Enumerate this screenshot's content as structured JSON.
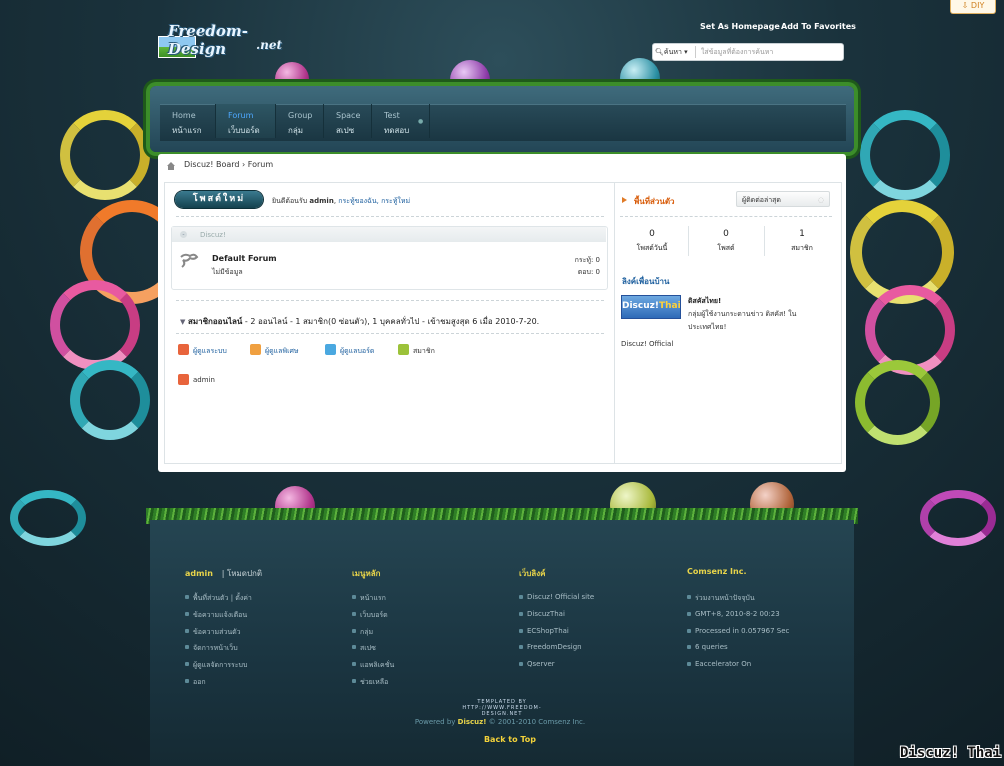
{
  "header": {
    "logo_text": "Freedom-Design",
    "logo_sub": ".net",
    "set_homepage": "Set As Homepage",
    "add_favorites": "Add To Favorites",
    "diy": "DIY",
    "search_select": "ค้นหา",
    "search_placeholder": "ใส่ข้อมูลที่ต้องการค้นหา"
  },
  "nav": {
    "items": [
      {
        "en": "Home",
        "th": "หน้าแรก"
      },
      {
        "en": "Forum",
        "th": "เว็บบอร์ด"
      },
      {
        "en": "Group",
        "th": "กลุ่ม"
      },
      {
        "en": "Space",
        "th": "สเปซ"
      },
      {
        "en": "Test",
        "th": "ทดสอบ"
      }
    ],
    "active_index": 1
  },
  "breadcrumb": {
    "board": "Discuz! Board",
    "sep": "›",
    "forum": "Forum"
  },
  "main": {
    "post_button": "โพสต์ใหม่",
    "welcome_prefix": "ยินดีต้อนรับ",
    "welcome_user": "admin",
    "welcome_rest": "กระทู้ของฉัน, กระทู้ใหม่",
    "category": {
      "title": "Discuz!",
      "forum_name": "Default Forum",
      "forum_desc": "ไม่มีข้อมูล",
      "threads": "กระทู้: 0",
      "posts": "ตอบ: 0"
    },
    "online": {
      "title": "สมาชิกออนไลน์",
      "summary": " - 2 ออนไลน์ - 1 สมาชิก(0 ซ่อนตัว), 1 บุคคลทั่วไป - เข้าชมสูงสุด 6 เมื่อ 2010-7-20.",
      "legends": [
        "ผู้ดูแลระบบ",
        "ผู้ดูแลพิเศษ",
        "ผู้ดูแลบอร์ด",
        "สมาชิก"
      ],
      "legend_colors": [
        "#e8643c",
        "#f0a040",
        "#4aa8e0",
        "#9cc23a"
      ],
      "user": "admin"
    }
  },
  "sidebar": {
    "title": "พื้นที่ส่วนตัว",
    "latest_button": "ผู้ติดต่อล่าสุด",
    "stats": [
      {
        "num": "0",
        "label": "โพสต์วันนี้"
      },
      {
        "num": "0",
        "label": "โพสต์"
      },
      {
        "num": "1",
        "label": "สมาชิก"
      }
    ],
    "links_title": "ลิงค์เพื่อนบ้าน",
    "link_logo": "Discuz!",
    "link_logo_thai": "Thai",
    "link_name": "ดิสคัสไทย!",
    "link_desc": "กลุ่มผู้ใช้งานกระดานข่าว ดิสคัส! ในประเทศไทย!",
    "official": "Discuz! Official"
  },
  "footer": {
    "col1": {
      "head": "admin",
      "head_suffix": "| โหมดปกติ",
      "items": [
        "พื้นที่ส่วนตัว | ตั้งค่า",
        "ข้อความแจ้งเตือน",
        "ข้อความส่วนตัว",
        "จัดการหน้าเว็บ",
        "ผู้ดูแลจัดการระบบ",
        "ออก"
      ]
    },
    "col2": {
      "head": "เมนูหลัก",
      "items": [
        "หน้าแรก",
        "เว็บบอร์ด",
        "กลุ่ม",
        "สเปซ",
        "แอพลิเคชั่น",
        "ช่วยเหลือ"
      ]
    },
    "col3": {
      "head": "เว็บลิงค์",
      "items": [
        "Discuz! Official site",
        "DiscuzThai",
        "ECShopThai",
        "FreedomDesign",
        "Qserver"
      ]
    },
    "col4": {
      "head": "Comsenz Inc.",
      "items": [
        "ร่วมงานหน้าปัจจุบัน",
        "GMT+8, 2010-8-2 00:23",
        "Processed in 0.057967 Sec",
        "6 queries",
        "Eaccelerator On"
      ]
    },
    "templated_1": "TEMPLATED BY",
    "templated_2": "HTTP://WWW.FREEDOM-DESIGN.NET",
    "powered_prefix": "Powered by",
    "powered_brand": "Discuz!",
    "powered_rest": "© 2001-2010 Comsenz Inc.",
    "back_to_top": "Back to Top"
  },
  "watermark": "Discuz! Thai",
  "colors": {
    "accent_orange": "#d85c0a",
    "link_blue": "#1d5f9e",
    "footer_yellow": "#e8d44a",
    "nav_active": "#4da8ff"
  }
}
